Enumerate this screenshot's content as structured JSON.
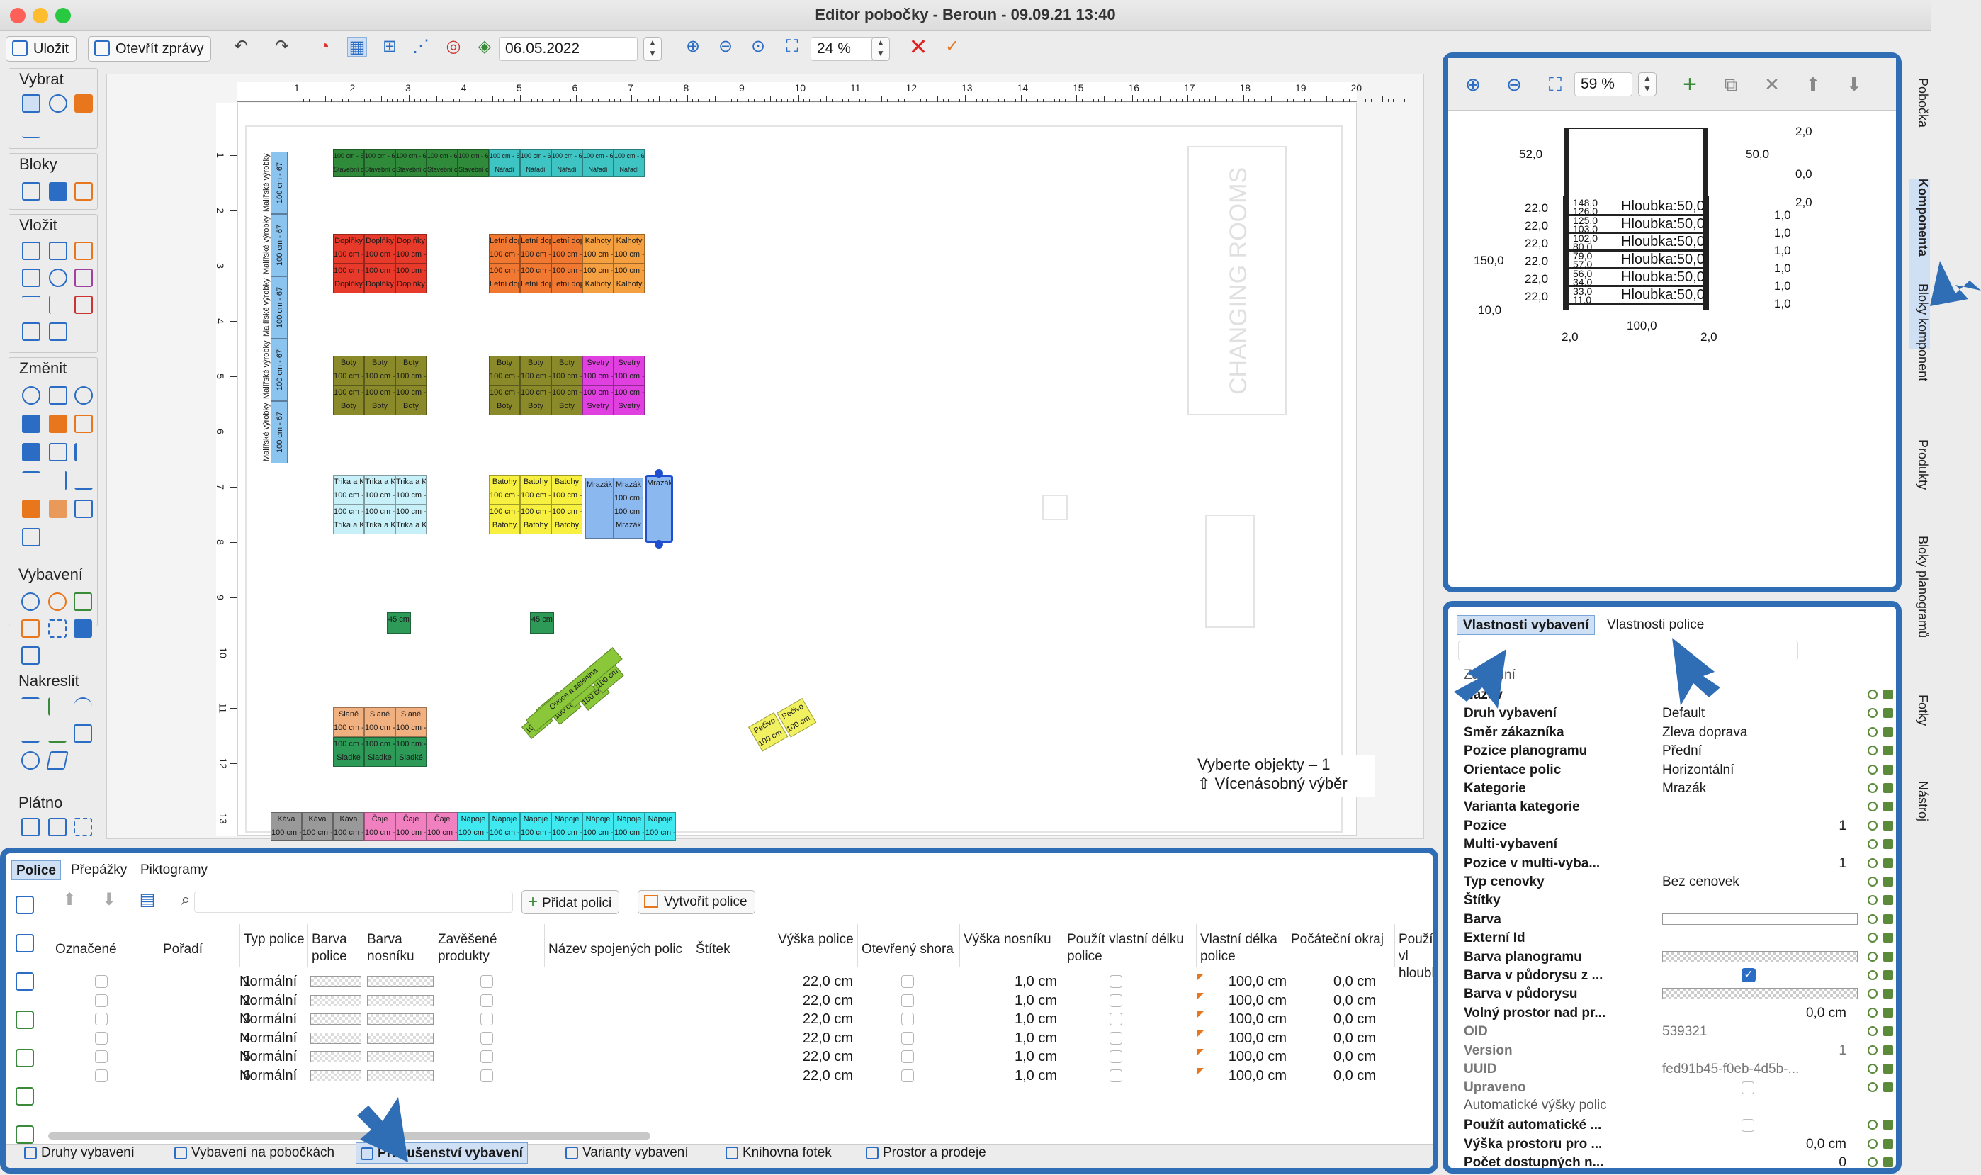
{
  "window": {
    "title": "Editor pobočky - Beroun - 09.09.21 13:40"
  },
  "toolbar": {
    "save": "Uložit",
    "open_reports": "Otevřít zprávy",
    "date": "06.05.2022",
    "zoom": "24 %"
  },
  "palette": {
    "sections": [
      "Vybrat",
      "Bloky",
      "Vložit",
      "Změnit",
      "Vybavení",
      "Nakreslit",
      "Plátno"
    ]
  },
  "ruler": {
    "top": [
      "1",
      "2",
      "3",
      "4",
      "5",
      "6",
      "7",
      "8",
      "9",
      "10",
      "11",
      "12",
      "13",
      "14",
      "15",
      "16",
      "17",
      "18",
      "19",
      "20"
    ],
    "left": [
      "1",
      "2",
      "3",
      "4",
      "5",
      "6",
      "7",
      "8",
      "9",
      "10",
      "11",
      "12",
      "13"
    ]
  },
  "floor": {
    "changing_rooms": "CHANGING ROOMS",
    "dim": "100 cm - 67",
    "top_row": [
      {
        "t": "Stavební chemie",
        "c": "#2f8a3a"
      },
      {
        "t": "Stavební chemie",
        "c": "#2f8a3a"
      },
      {
        "t": "Stavební chemie",
        "c": "#2f8a3a"
      },
      {
        "t": "Stavební chemie",
        "c": "#2f8a3a"
      },
      {
        "t": "Stavební chemie",
        "c": "#2f8a3a"
      },
      {
        "t": "Nářadí",
        "c": "#3fc4c4"
      },
      {
        "t": "Nářadí",
        "c": "#3fc4c4"
      },
      {
        "t": "Nářadí",
        "c": "#3fc4c4"
      },
      {
        "t": "Nářadí",
        "c": "#3fc4c4"
      },
      {
        "t": "Nářadí",
        "c": "#3fc4c4"
      }
    ],
    "left_column": "Malířské výrobky",
    "groups": [
      {
        "label": "Doplňky",
        "c": "#e83a2a"
      },
      {
        "label": "Letní doplňky",
        "c": "#f07830"
      },
      {
        "label": "Kalhoty",
        "c": "#f4a040"
      },
      {
        "label": "Boty",
        "c": "#8a8a2a"
      },
      {
        "label": "Boty",
        "c": "#8a8a2a"
      },
      {
        "label": "Svetry",
        "c": "#e040e0"
      },
      {
        "label": "Trika a Košile",
        "c": "#c8f0f8"
      },
      {
        "label": "Batohy",
        "c": "#f8f040"
      },
      {
        "label": "Mrazák",
        "c": "#8cb8f0"
      },
      {
        "label": "Slané",
        "c": "#f0b080"
      },
      {
        "label": "Sladké",
        "c": "#2e9a58"
      },
      {
        "label": "Ovoce a zelenina",
        "c": "#8ac83a"
      },
      {
        "label": "Pečivo",
        "c": "#f0f060"
      }
    ],
    "small_box": "45 cm",
    "bottom_row": [
      {
        "t": "Káva",
        "c": "#999999"
      },
      {
        "t": "Káva",
        "c": "#999999"
      },
      {
        "t": "Káva",
        "c": "#999999"
      },
      {
        "t": "Čaje",
        "c": "#f080c0"
      },
      {
        "t": "Čaje",
        "c": "#f080c0"
      },
      {
        "t": "Čaje",
        "c": "#f080c0"
      },
      {
        "t": "Nápoje",
        "c": "#40e8f0"
      },
      {
        "t": "Nápoje",
        "c": "#40e8f0"
      },
      {
        "t": "Nápoje",
        "c": "#40e8f0"
      },
      {
        "t": "Nápoje",
        "c": "#40e8f0"
      },
      {
        "t": "Nápoje",
        "c": "#40e8f0"
      },
      {
        "t": "Nápoje",
        "c": "#40e8f0"
      },
      {
        "t": "Nápoje",
        "c": "#40e8f0"
      }
    ],
    "tooltip": {
      "line1": "Vyberte objekty – 1",
      "line2": "⇧ Vícenásobný výběr"
    }
  },
  "preview": {
    "zoom": "59 %",
    "dims": {
      "top_w_left": "52,0",
      "top_w_right": "50,0",
      "top_2": "2,0",
      "top_0": "0,0",
      "base_2": "2,0",
      "left_gap": "22,0",
      "side_1": "1,0",
      "height": "150,0",
      "bottom_10": "10,0",
      "bottom_2l": "2,0",
      "bottom_100": "100,0",
      "bottom_2r": "2,0"
    },
    "shelves": [
      {
        "a": "148,0",
        "b": "126,0",
        "depth": "Hloubka:50,0"
      },
      {
        "a": "125,0",
        "b": "103,0",
        "depth": "Hloubka:50,0"
      },
      {
        "a": "102,0",
        "b": "80,0",
        "depth": "Hloubka:50,0"
      },
      {
        "a": "79,0",
        "b": "57,0",
        "depth": "Hloubka:50,0"
      },
      {
        "a": "56,0",
        "b": "34,0",
        "depth": "Hloubka:50,0"
      },
      {
        "a": "33,0",
        "b": "11,0",
        "depth": "Hloubka:50,0"
      }
    ]
  },
  "props": {
    "tabs": [
      "Vlastnosti vybavení",
      "Vlastnosti police"
    ],
    "section": "Základní",
    "rows": [
      {
        "k": "Název",
        "v": ""
      },
      {
        "k": "Druh vybavení",
        "v": "Default"
      },
      {
        "k": "Směr zákazníka",
        "v": "Zleva doprava"
      },
      {
        "k": "Pozice planogramu",
        "v": "Přední"
      },
      {
        "k": "Orientace polic",
        "v": "Horizontální"
      },
      {
        "k": "Kategorie",
        "v": "Mrazák"
      },
      {
        "k": "Varianta kategorie",
        "v": ""
      },
      {
        "k": "Pozice",
        "v": "1"
      },
      {
        "k": "Multi-vybavení",
        "v": ""
      },
      {
        "k": "Pozice v multi-vyba...",
        "v": "1"
      },
      {
        "k": "Typ cenovky",
        "v": "Bez cenovek"
      },
      {
        "k": "Štítky",
        "v": ""
      },
      {
        "k": "Barva",
        "v": ""
      },
      {
        "k": "Externí Id",
        "v": ""
      },
      {
        "k": "Barva planogramu",
        "v": ""
      },
      {
        "k": "Barva v půdorysu z ...",
        "v": ""
      },
      {
        "k": "Barva v půdorysu",
        "v": ""
      },
      {
        "k": "Volný prostor nad pr...",
        "v": "0,0 cm"
      },
      {
        "k": "OID",
        "v": "539321"
      },
      {
        "k": "Version",
        "v": "1"
      },
      {
        "k": "UUID",
        "v": "fed91b45-f0eb-4d5b-..."
      },
      {
        "k": "Upraveno",
        "v": ""
      }
    ],
    "section2": "Automatické výšky polic",
    "rows2": [
      {
        "k": "Použít automatické ...",
        "v": ""
      },
      {
        "k": "Výška prostoru pro ...",
        "v": "0,0 cm"
      },
      {
        "k": "Počet dostupných n...",
        "v": "0"
      }
    ]
  },
  "sidetabs": [
    "Pobočka",
    "Komponenta",
    "Bloky komponent",
    "Produkty",
    "Bloky planogramů",
    "Fotky",
    "Nástroj"
  ],
  "bottom": {
    "tabs": [
      "Police",
      "Přepážky",
      "Piktogramy"
    ],
    "add_shelf": "Přidat polici",
    "create_shelves": "Vytvořit police",
    "headers": [
      "Označené",
      "Pořadí",
      "Typ police",
      "Barva police",
      "Barva nosníku",
      "Zavěšené produkty",
      "Název spojených polic",
      "Štítek",
      "Výška police",
      "Otevřený shora",
      "Výška nosníku",
      "Použít vlastní délku police",
      "Vlastní délka police",
      "Počáteční okraj",
      "Použít vl hloubku"
    ],
    "rows": [
      {
        "n": "1",
        "type": "Normální",
        "h": "22,0 cm",
        "hn": "1,0 cm",
        "len": "100,0 cm",
        "edge": "0,0 cm"
      },
      {
        "n": "2",
        "type": "Normální",
        "h": "22,0 cm",
        "hn": "1,0 cm",
        "len": "100,0 cm",
        "edge": "0,0 cm"
      },
      {
        "n": "3",
        "type": "Normální",
        "h": "22,0 cm",
        "hn": "1,0 cm",
        "len": "100,0 cm",
        "edge": "0,0 cm"
      },
      {
        "n": "4",
        "type": "Normální",
        "h": "22,0 cm",
        "hn": "1,0 cm",
        "len": "100,0 cm",
        "edge": "0,0 cm"
      },
      {
        "n": "5",
        "type": "Normální",
        "h": "22,0 cm",
        "hn": "1,0 cm",
        "len": "100,0 cm",
        "edge": "0,0 cm"
      },
      {
        "n": "6",
        "type": "Normální",
        "h": "22,0 cm",
        "hn": "1,0 cm",
        "len": "100,0 cm",
        "edge": "0,0 cm"
      }
    ],
    "window_tabs": [
      "Druhy vybavení",
      "Vybavení na pobočkách",
      "Příslušenství vybavení",
      "Varianty vybavení",
      "Knihovna fotek",
      "Prostor a prodeje"
    ]
  },
  "colors": {
    "accent": "#2f6db5",
    "arrow": "#2f6db5"
  }
}
